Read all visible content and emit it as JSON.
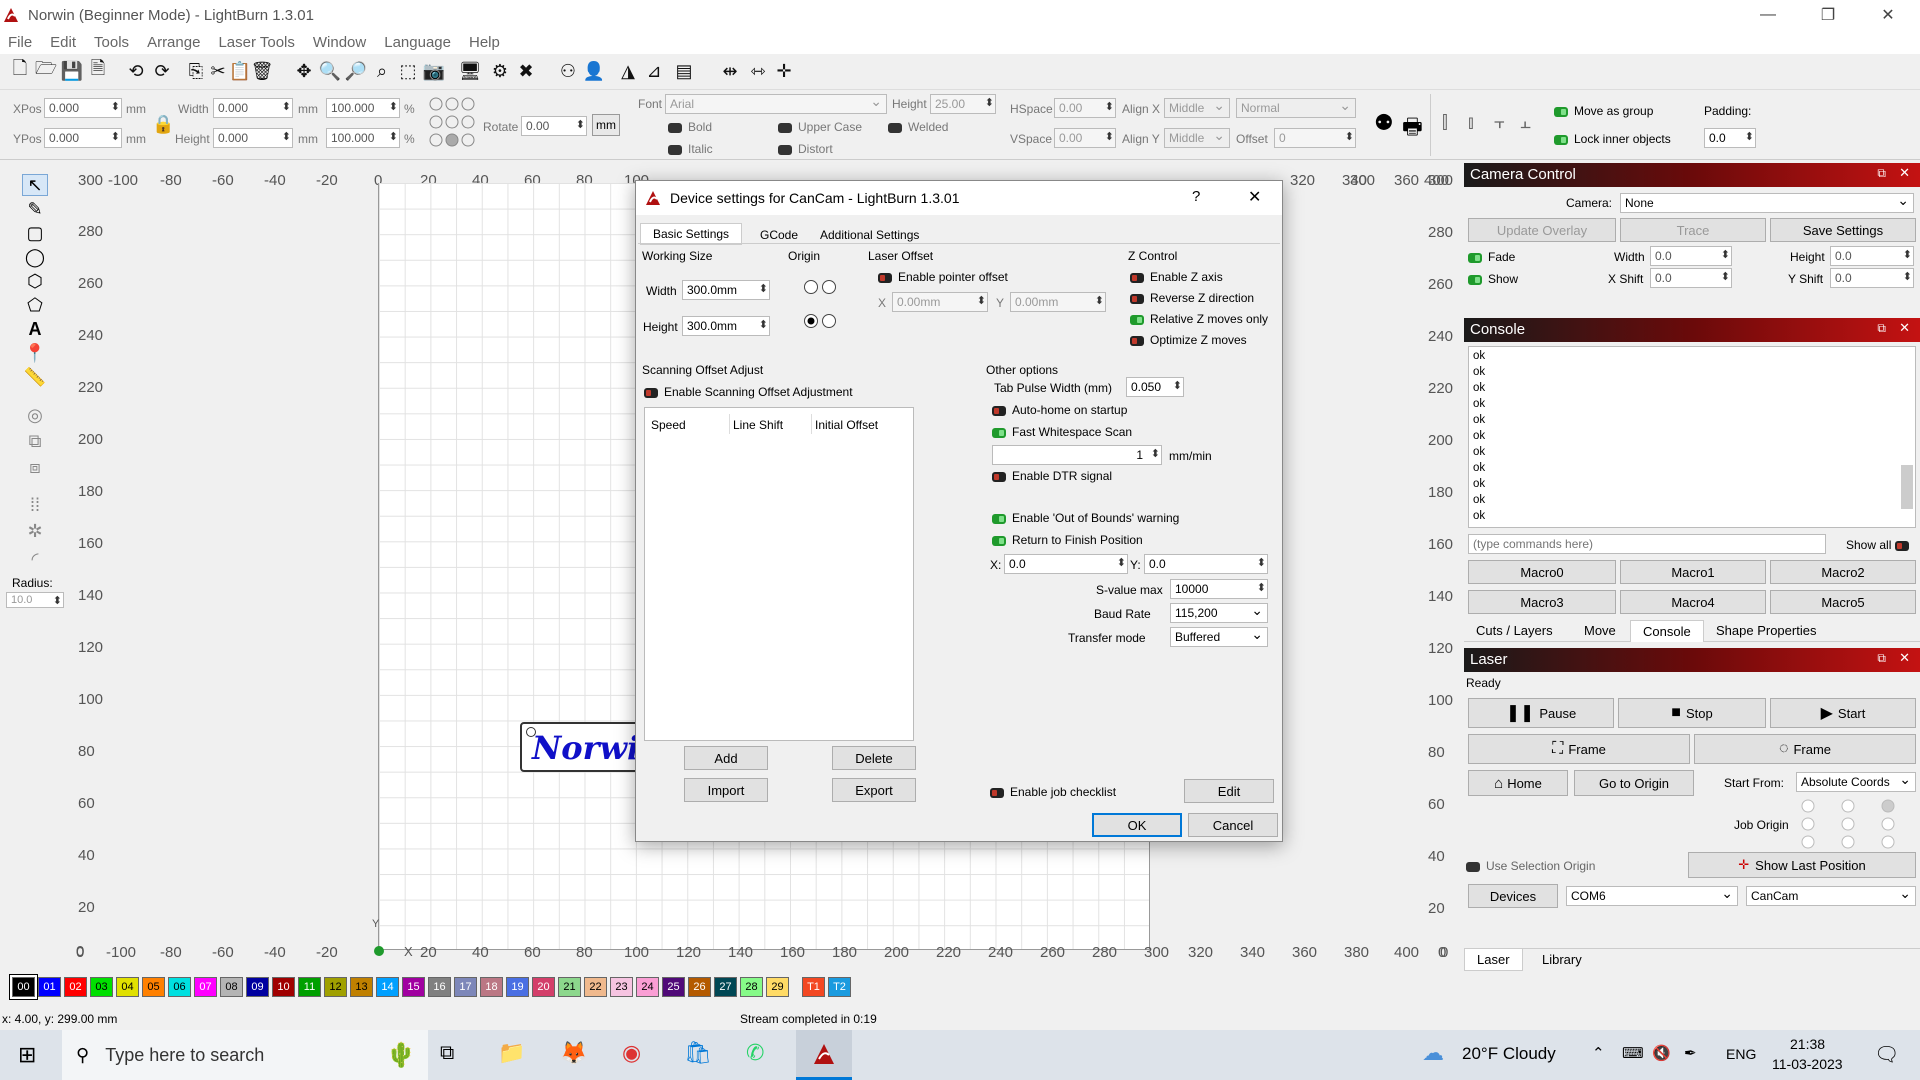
{
  "window": {
    "title": "Norwin (Beginner Mode) - LightBurn 1.3.01",
    "min": "—",
    "max": "❐",
    "close": "✕"
  },
  "menu": [
    "File",
    "Edit",
    "Tools",
    "Arrange",
    "Laser Tools",
    "Window",
    "Language",
    "Help"
  ],
  "props": {
    "xpos_label": "XPos",
    "xpos": "0.000",
    "ypos_label": "YPos",
    "ypos": "0.000",
    "unit": "mm",
    "width_label": "Width",
    "width": "0.000",
    "height_label": "Height",
    "height": "0.000",
    "pct1": "100.000",
    "pct2": "100.000",
    "pct": "%",
    "rotate_label": "Rotate",
    "rotate": "0.00",
    "mm_btn": "mm",
    "font_label": "Font",
    "font": "Arial",
    "fheight_label": "Height",
    "fheight": "25.00",
    "hspace_label": "HSpace",
    "hspace": "0.00",
    "vspace_label": "VSpace",
    "vspace": "0.00",
    "alignx_label": "Align X",
    "alignx": "Middle",
    "aligny_label": "Align Y",
    "aligny": "Middle",
    "normal": "Normal",
    "offset_label": "Offset",
    "offset": "0",
    "bold": "Bold",
    "italic": "Italic",
    "upper": "Upper Case",
    "welded": "Welded",
    "distort": "Distort",
    "move_group": "Move as group",
    "lock_inner": "Lock inner objects",
    "padding_label": "Padding:",
    "padding": "0.0"
  },
  "radius": {
    "label": "Radius:",
    "value": "10.0"
  },
  "ruler": {
    "top": [
      "300",
      "-100",
      "-80",
      "-60",
      "-40",
      "-20",
      "0",
      "20",
      "40",
      "60",
      "80",
      "100",
      "120",
      "140",
      "160",
      "180",
      "200",
      "220",
      "240",
      "260",
      "280",
      "300",
      "320",
      "340",
      "360",
      "380",
      "400"
    ],
    "left": [
      "300",
      "280",
      "260",
      "240",
      "220",
      "200",
      "180",
      "160",
      "140",
      "120",
      "100",
      "80",
      "60",
      "40",
      "20",
      "0"
    ],
    "right": [
      "300",
      "280",
      "260",
      "240",
      "220",
      "200",
      "180",
      "160",
      "140",
      "120",
      "100",
      "80",
      "60",
      "40",
      "20",
      "0"
    ],
    "bottom": [
      "0",
      "-100",
      "-80",
      "-60",
      "-40",
      "-20",
      "0",
      "20",
      "40",
      "60",
      "80",
      "100",
      "120",
      "140",
      "160",
      "180",
      "200",
      "220",
      "240",
      "260",
      "280",
      "300",
      "320",
      "340",
      "360",
      "380",
      "400",
      "0"
    ],
    "x": "X",
    "y": "Y"
  },
  "canvas_text": "Norwi",
  "palette": [
    {
      "l": "00",
      "c": "#000000",
      "t": "#fff"
    },
    {
      "l": "01",
      "c": "#0000ff",
      "t": "#fff"
    },
    {
      "l": "02",
      "c": "#ff0000",
      "t": "#fff"
    },
    {
      "l": "03",
      "c": "#00e000",
      "t": "#000"
    },
    {
      "l": "04",
      "c": "#e0e000",
      "t": "#000"
    },
    {
      "l": "05",
      "c": "#ff8000",
      "t": "#000"
    },
    {
      "l": "06",
      "c": "#00e0e0",
      "t": "#000"
    },
    {
      "l": "07",
      "c": "#ff00ff",
      "t": "#fff"
    },
    {
      "l": "08",
      "c": "#b4b4b4",
      "t": "#000"
    },
    {
      "l": "09",
      "c": "#0000a0",
      "t": "#fff"
    },
    {
      "l": "10",
      "c": "#a00000",
      "t": "#fff"
    },
    {
      "l": "11",
      "c": "#00a000",
      "t": "#fff"
    },
    {
      "l": "12",
      "c": "#a0a000",
      "t": "#000"
    },
    {
      "l": "13",
      "c": "#c08000",
      "t": "#000"
    },
    {
      "l": "14",
      "c": "#00a0ff",
      "t": "#fff"
    },
    {
      "l": "15",
      "c": "#a000a0",
      "t": "#fff"
    },
    {
      "l": "16",
      "c": "#808080",
      "t": "#fff"
    },
    {
      "l": "17",
      "c": "#7d87b9",
      "t": "#fff"
    },
    {
      "l": "18",
      "c": "#bb7784",
      "t": "#fff"
    },
    {
      "l": "19",
      "c": "#4a6fe3",
      "t": "#fff"
    },
    {
      "l": "20",
      "c": "#d33f6a",
      "t": "#fff"
    },
    {
      "l": "21",
      "c": "#8cd78c",
      "t": "#000"
    },
    {
      "l": "22",
      "c": "#f0b98d",
      "t": "#000"
    },
    {
      "l": "23",
      "c": "#f6c4e1",
      "t": "#000"
    },
    {
      "l": "24",
      "c": "#fa9ed4",
      "t": "#000"
    },
    {
      "l": "25",
      "c": "#500a78",
      "t": "#fff"
    },
    {
      "l": "26",
      "c": "#b45a00",
      "t": "#fff"
    },
    {
      "l": "27",
      "c": "#004754",
      "t": "#fff"
    },
    {
      "l": "28",
      "c": "#86fa88",
      "t": "#000"
    },
    {
      "l": "29",
      "c": "#ffdb66",
      "t": "#000"
    },
    {
      "l": "T1",
      "c": "#f34822",
      "t": "#fff"
    },
    {
      "l": "T2",
      "c": "#1a9bdf",
      "t": "#fff"
    }
  ],
  "status": {
    "coords": "x: 4.00, y: 299.00 mm",
    "stream": "Stream completed in 0:19"
  },
  "dialog": {
    "title": "Device settings for CanCam - LightBurn 1.3.01",
    "help": "?",
    "close": "✕",
    "tabs": [
      "Basic Settings",
      "GCode",
      "Additional Settings"
    ],
    "working_size": "Working Size",
    "width_label": "Width",
    "width": "300.0mm",
    "height_label": "Height",
    "height": "300.0mm",
    "origin": "Origin",
    "laser_offset": "Laser Offset",
    "enable_pointer": "Enable pointer offset",
    "x_label": "X",
    "x_val": "0.00mm",
    "y_label": "Y",
    "y_val": "0.00mm",
    "z_control": "Z Control",
    "z_items": [
      "Enable Z axis",
      "Reverse Z direction",
      "Relative Z moves only",
      "Optimize Z moves"
    ],
    "scan_title": "Scanning Offset Adjust",
    "scan_enable": "Enable Scanning Offset Adjustment",
    "cols": [
      "Speed",
      "Line Shift",
      "Initial Offset"
    ],
    "add": "Add",
    "delete": "Delete",
    "import": "Import",
    "export": "Export",
    "other": "Other options",
    "tab_pulse_label": "Tab Pulse Width (mm)",
    "tab_pulse": "0.050",
    "autohome": "Auto-home on startup",
    "fast_ws": "Fast Whitespace Scan",
    "ws_val": "1",
    "ws_unit": "mm/min",
    "dtr": "Enable DTR signal",
    "oob": "Enable 'Out of Bounds' warning",
    "return_finish": "Return to Finish Position",
    "rx_label": "X:",
    "rx": "0.0",
    "ry_label": "Y:",
    "ry": "0.0",
    "svalue_label": "S-value max",
    "svalue": "10000",
    "baud_label": "Baud Rate",
    "baud": "115,200",
    "transfer_label": "Transfer mode",
    "transfer": "Buffered",
    "checklist": "Enable job checklist",
    "edit": "Edit",
    "ok": "OK",
    "cancel": "Cancel"
  },
  "camera": {
    "title": "Camera Control",
    "camera_label": "Camera:",
    "camera": "None",
    "update": "Update Overlay",
    "trace": "Trace",
    "save": "Save Settings",
    "fade": "Fade",
    "show": "Show",
    "width_label": "Width",
    "width": "0.0",
    "height_label": "Height",
    "height": "0.0",
    "xshift_label": "X Shift",
    "xshift": "0.0",
    "yshift_label": "Y Shift",
    "yshift": "0.0"
  },
  "console": {
    "title": "Console",
    "lines": [
      "ok",
      "ok",
      "ok",
      "ok",
      "ok",
      "ok",
      "ok",
      "ok",
      "ok",
      "ok",
      "ok"
    ],
    "placeholder": "(type commands here)",
    "show_all": "Show all",
    "macros": [
      "Macro0",
      "Macro1",
      "Macro2",
      "Macro3",
      "Macro4",
      "Macro5"
    ],
    "tabs": [
      "Cuts / Layers",
      "Move",
      "Console",
      "Shape Properties"
    ]
  },
  "laser": {
    "title": "Laser",
    "status": "Ready",
    "pause": "Pause",
    "stop": "Stop",
    "start": "Start",
    "frame1": "Frame",
    "frame2": "Frame",
    "home": "Home",
    "goto": "Go to Origin",
    "start_from_label": "Start From:",
    "start_from": "Absolute Coords",
    "job_origin": "Job Origin",
    "use_sel": "Use Selection Origin",
    "show_last": "Show Last Position",
    "devices": "Devices",
    "port": "COM6",
    "device": "CanCam",
    "tabs": [
      "Laser",
      "Library"
    ]
  },
  "taskbar": {
    "search": "Type here to search",
    "weather": "20°F  Cloudy",
    "lang": "ENG",
    "time": "21:38",
    "date": "11-03-2023"
  },
  "colors": {
    "accent": "#0078d7",
    "header_red": "#c41212",
    "toggle_on": "#1f9a2c",
    "toggle_off": "#c0392b"
  }
}
